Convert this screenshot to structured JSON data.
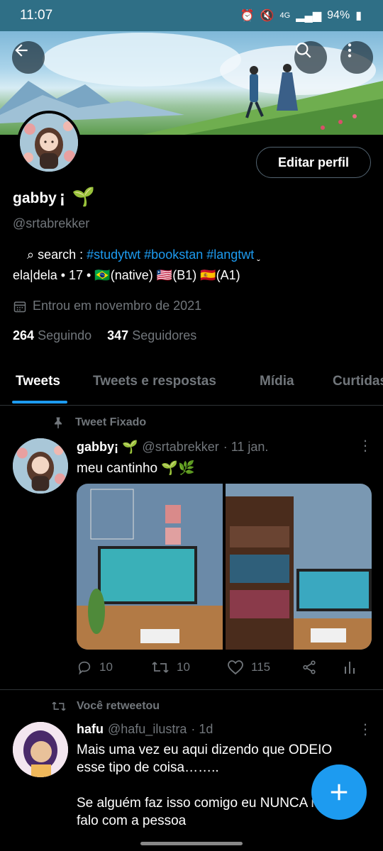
{
  "status_bar": {
    "time": "11:07",
    "network": "4G",
    "battery": "94%"
  },
  "profile": {
    "edit_button": "Editar perfil",
    "name": "gabby",
    "name_suffix": "¡",
    "name_emoji": "🌱",
    "handle": "@srtabrekker",
    "bio_line1_prefix": "⌕   search : ",
    "bio_line1_tags": "#studytwt #bookstan #langtwt",
    "bio_line1_suffix": " ˬ",
    "bio_line2": "ela|dela • 17 • 🇧🇷(native) 🇱🇷(B1) 🇪🇸(A1)",
    "joined": "Entrou em novembro de 2021",
    "following_count": "264",
    "following_label": "Seguindo",
    "followers_count": "347",
    "followers_label": "Seguidores"
  },
  "tabs": [
    "Tweets",
    "Tweets e respostas",
    "Mídia",
    "Curtidas"
  ],
  "pinned_tweet": {
    "context": "Tweet Fixado",
    "name": "gabby¡ 🌱",
    "handle": "@srtabrekker",
    "date": "· 11 jan.",
    "text": "meu cantinho 🌱🌿",
    "replies": "10",
    "retweets": "10",
    "likes": "115"
  },
  "retweet": {
    "context": "Você retweetou",
    "name": "hafu",
    "handle": "@hafu_ilustra",
    "date": "· 1d",
    "text_line1": "Mais uma vez eu aqui dizendo que ODEIO",
    "text_line2": "esse tipo de coisa……..",
    "text_line3": "Se alguém faz isso comigo eu NUNCA mais",
    "text_line4": "falo com a pessoa"
  },
  "colors": {
    "accent": "#1d9bf0",
    "status_bar": "#2f6f86",
    "muted": "#71767b"
  },
  "icons": [
    "back-arrow-icon",
    "search-icon",
    "more-vertical-icon",
    "calendar-icon",
    "pin-icon",
    "reply-icon",
    "retweet-icon",
    "like-icon",
    "share-icon",
    "analytics-icon",
    "compose-plus-icon"
  ]
}
